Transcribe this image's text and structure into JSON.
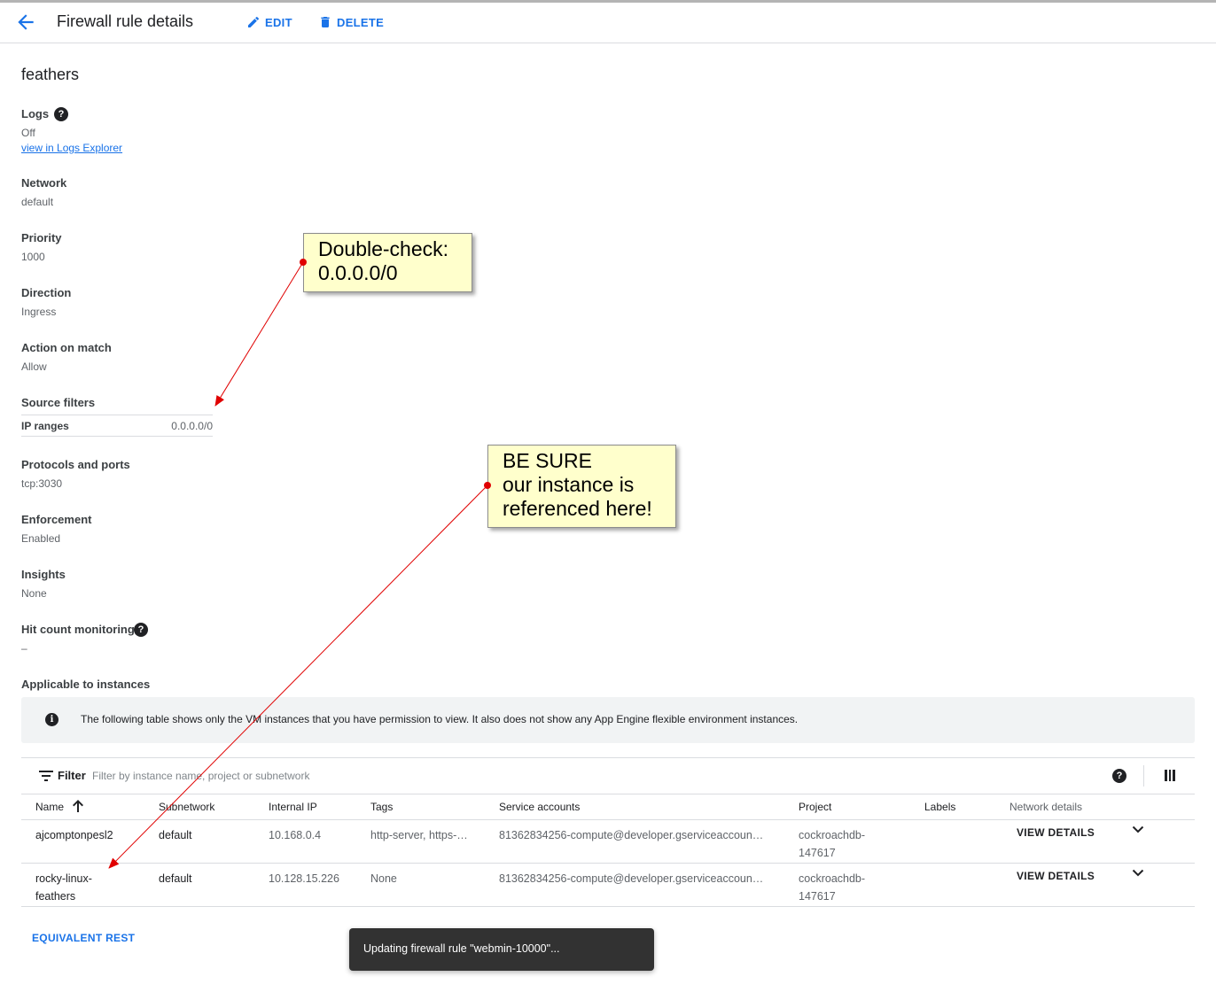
{
  "header": {
    "title": "Firewall rule details",
    "edit_label": "EDIT",
    "delete_label": "DELETE"
  },
  "rule": {
    "name": "feathers",
    "logs": {
      "label": "Logs",
      "value": "Off",
      "link": "view in Logs Explorer"
    },
    "network": {
      "label": "Network",
      "value": "default"
    },
    "priority": {
      "label": "Priority",
      "value": "1000"
    },
    "direction": {
      "label": "Direction",
      "value": "Ingress"
    },
    "action": {
      "label": "Action on match",
      "value": "Allow"
    },
    "source_filters": {
      "label": "Source filters",
      "ip_ranges_label": "IP ranges",
      "ip_ranges_value": "0.0.0.0/0"
    },
    "protocols": {
      "label": "Protocols and ports",
      "value": "tcp:3030"
    },
    "enforcement": {
      "label": "Enforcement",
      "value": "Enabled"
    },
    "insights": {
      "label": "Insights",
      "value": "None"
    },
    "hit_count": {
      "label": "Hit count monitoring",
      "value": "–"
    },
    "applicable": {
      "label": "Applicable to instances"
    }
  },
  "info_banner": "The following table shows only the VM instances that you have permission to view. It also does not show any App Engine flexible environment instances.",
  "table": {
    "filter_label": "Filter",
    "filter_placeholder": "Filter by instance name, project or subnetwork",
    "columns": [
      "Name",
      "Subnetwork",
      "Internal IP",
      "Tags",
      "Service accounts",
      "Project",
      "Labels",
      "Network details"
    ],
    "rows": [
      {
        "name": "ajcomptonpesl2",
        "subnetwork": "default",
        "internal_ip": "10.168.0.4",
        "tags": "http-server, https-…",
        "service_account": "81362834256-compute@developer.gserviceaccoun…",
        "project": "cockroachdb-147617",
        "labels": "",
        "action": "VIEW DETAILS"
      },
      {
        "name": "rocky-linux-feathers",
        "subnetwork": "default",
        "internal_ip": "10.128.15.226",
        "tags": "None",
        "service_account": "81362834256-compute@developer.gserviceaccoun…",
        "project": "cockroachdb-147617",
        "labels": "",
        "action": "VIEW DETAILS"
      }
    ]
  },
  "equivalent_rest": "EQUIVALENT REST",
  "toast": "Updating firewall rule \"webmin-10000\"...",
  "annotations": {
    "callout_1": "Double-check:\n0.0.0.0/0",
    "callout_2": "BE SURE\nour instance is\nreferenced here!"
  },
  "colors": {
    "accent": "#1a73e8",
    "callout_bg": "#ffffcc",
    "arrow": "#e00000",
    "toast_bg": "#323232"
  }
}
